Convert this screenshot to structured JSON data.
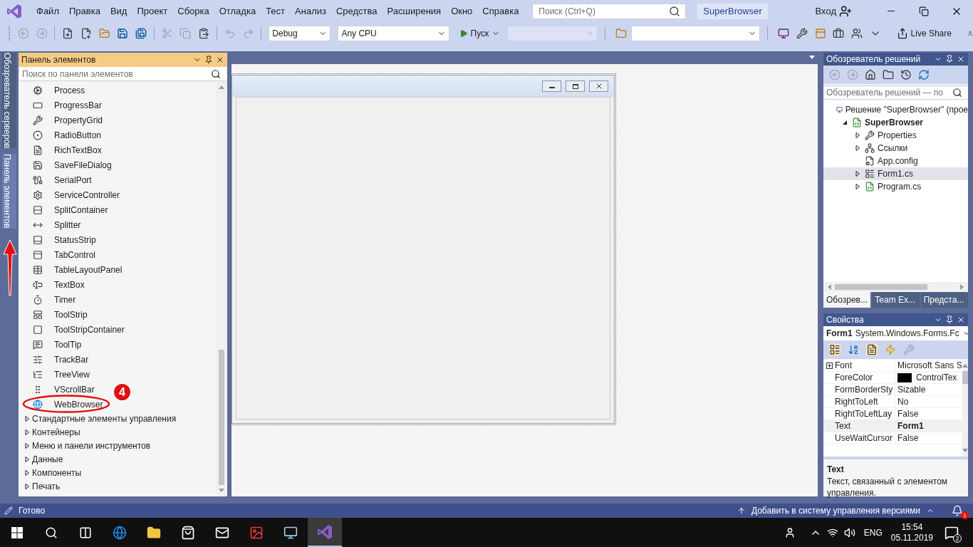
{
  "menu_bar": {
    "items": [
      "Файл",
      "Правка",
      "Вид",
      "Проект",
      "Сборка",
      "Отладка",
      "Тест",
      "Анализ",
      "Средства",
      "Расширения",
      "Окно",
      "Справка"
    ],
    "search": {
      "placeholder": "Поиск (Ctrl+Q)"
    },
    "solution_name": "SuperBrowser",
    "sign_in": "Вход"
  },
  "toolbar": {
    "configuration": "Debug",
    "platform": "Any CPU",
    "start": "Пуск",
    "live_share": "Live Share"
  },
  "side_tabs": [
    {
      "label": "Обозреватель серверов",
      "selected": false
    },
    {
      "label": "Панель элементов",
      "selected": true
    }
  ],
  "toolbox": {
    "title": "Панель элементов",
    "search": {
      "placeholder": "Поиск по панели элементов"
    },
    "items": [
      "Process",
      "ProgressBar",
      "PropertyGrid",
      "RadioButton",
      "RichTextBox",
      "SaveFileDialog",
      "SerialPort",
      "ServiceController",
      "SplitContainer",
      "Splitter",
      "StatusStrip",
      "TabControl",
      "TableLayoutPanel",
      "TextBox",
      "Timer",
      "ToolStrip",
      "ToolStripContainer",
      "ToolTip",
      "TrackBar",
      "TreeView",
      "VScrollBar",
      "WebBrowser"
    ],
    "groups": [
      {
        "label": "Стандартные элементы управления",
        "expanded": false
      },
      {
        "label": "Контейнеры",
        "expanded": false
      },
      {
        "label": "Меню и панели инструментов",
        "expanded": false
      },
      {
        "label": "Данные",
        "expanded": false
      },
      {
        "label": "Компоненты",
        "expanded": false
      },
      {
        "label": "Печать",
        "expanded": false
      }
    ]
  },
  "annotation": {
    "step": "4"
  },
  "solution_explorer": {
    "title": "Обозреватель решений",
    "search": {
      "placeholder": "Обозреватель решений — по"
    },
    "tree": [
      {
        "label": "Решение \"SuperBrowser\" (прое",
        "kind": "solution",
        "selected": false,
        "children": [
          {
            "label": "SuperBrowser",
            "kind": "project",
            "selected": false,
            "expanded": true,
            "children": [
              {
                "label": "Properties",
                "kind": "properties",
                "selected": false,
                "expanded": false
              },
              {
                "label": "Ссылки",
                "kind": "references",
                "selected": false,
                "expanded": false
              },
              {
                "label": "App.config",
                "kind": "config",
                "selected": false
              },
              {
                "label": "Form1.cs",
                "kind": "form",
                "selected": true,
                "expanded": false
              },
              {
                "label": "Program.cs",
                "kind": "code",
                "selected": false,
                "expanded": false
              }
            ]
          }
        ]
      }
    ],
    "tabs": [
      {
        "label": "Обозрев...",
        "selected": true
      },
      {
        "label": "Team Ex...",
        "selected": false
      },
      {
        "label": "Предста...",
        "selected": false
      }
    ]
  },
  "properties": {
    "title": "Свойства",
    "object": "Form1",
    "type": "System.Windows.Forms.Fc",
    "rows": [
      {
        "name": "Font",
        "value": "Microsoft Sans S",
        "expanded": false,
        "modified": false,
        "selected": false
      },
      {
        "name": "ForeColor",
        "value": "ControlTex",
        "color": "#000000",
        "modified": false,
        "selected": false
      },
      {
        "name": "FormBorderSty",
        "value": "Sizable",
        "modified": false,
        "selected": false
      },
      {
        "name": "RightToLeft",
        "value": "No",
        "modified": false,
        "selected": false
      },
      {
        "name": "RightToLeftLay",
        "value": "False",
        "modified": false,
        "selected": false
      },
      {
        "name": "Text",
        "value": "Form1",
        "modified": true,
        "selected": true
      },
      {
        "name": "UseWaitCursor",
        "value": "False",
        "modified": false,
        "selected": false
      }
    ],
    "description": {
      "title": "Text",
      "text": "Текст, связанный с элементом управления."
    }
  },
  "status_bar": {
    "text": "Готово",
    "source_control": "Добавить в систему управления версиями",
    "notifications": "1"
  },
  "taskbar": {
    "language": "ENG",
    "time": "15:54",
    "date": "05.11.2019",
    "notifications": "2"
  }
}
